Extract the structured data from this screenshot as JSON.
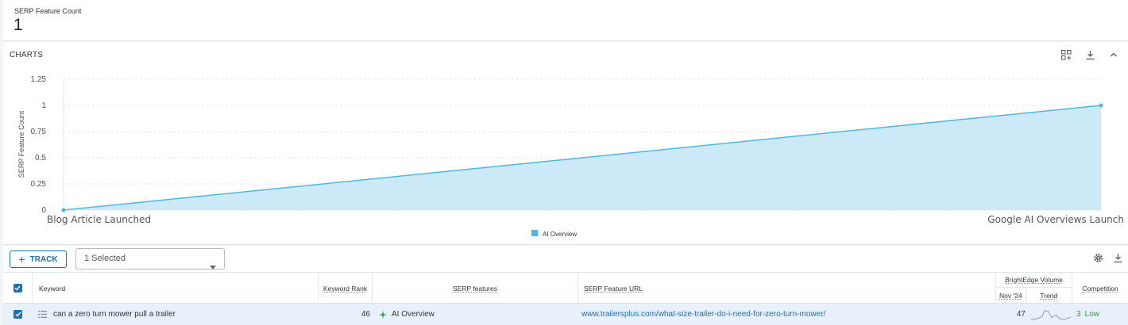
{
  "metric": {
    "label": "SERP Feature Count",
    "value": "1"
  },
  "charts": {
    "title": "CHARTS"
  },
  "chart_data": {
    "type": "area",
    "x": [
      "Blog Article Launched",
      "Google AI Overviews Launch"
    ],
    "series": [
      {
        "name": "AI Overview",
        "values": [
          0,
          1
        ]
      }
    ],
    "ylabel": "SERP Feature Count",
    "yticks": [
      "0",
      "0.25",
      "0.5",
      "0.75",
      "1",
      "1.25"
    ],
    "ylim": [
      0,
      1.25
    ],
    "grid": true,
    "legend": "bottom-center",
    "color": "#4fb8e2"
  },
  "toolbar": {
    "track_label": "TRACK",
    "select_value": "1 Selected"
  },
  "table": {
    "headers": {
      "keyword": "Keyword",
      "rank": "Keyword Rank",
      "features": "SERP features",
      "url": "SERP Feature URL",
      "volume_group": "BrightEdge Volume",
      "volume_month": "Nov '24",
      "trend": "Trend",
      "competition": "Competition"
    },
    "rows": [
      {
        "keyword": "can a zero turn mower pull a trailer",
        "rank": "46",
        "feature": "AI Overview",
        "url": "www.trailersplus.com/what-size-trailer-do-i-need-for-zero-turn-mower/",
        "volume": "47",
        "competition_score": "3",
        "competition_level": "Low"
      }
    ]
  },
  "colors": {
    "accent": "#1f6fb5",
    "area_fill": "#c5e7f5",
    "area_line": "#4fb8e2",
    "row_highlight": "#e8f1fb",
    "low": "#2f9e44"
  }
}
